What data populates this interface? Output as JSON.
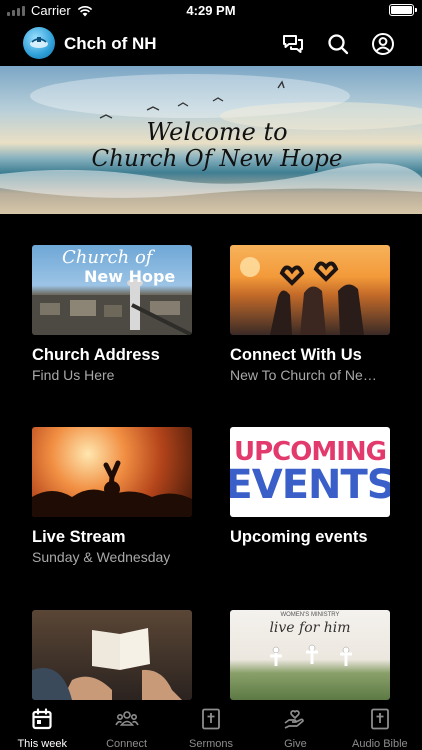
{
  "status_bar": {
    "carrier": "Carrier",
    "time": "4:29 PM"
  },
  "header": {
    "title": "Chch of NH",
    "icons": [
      "chat-icon",
      "search-icon",
      "profile-icon"
    ]
  },
  "hero": {
    "line1": "Welcome to",
    "line2": "Church Of New Hope"
  },
  "cards": [
    {
      "title": "Church Address",
      "subtitle": "Find Us Here",
      "thumb_text_1": "Church of",
      "thumb_text_2": "New Hope"
    },
    {
      "title": "Connect With Us",
      "subtitle": "New To Church of New Hope"
    },
    {
      "title": "Live Stream",
      "subtitle": "Sunday & Wednesday"
    },
    {
      "title": "Upcoming events",
      "subtitle": "",
      "thumb_text_1": "UPCOMING",
      "thumb_text_2": "EVENTS"
    },
    {
      "title": "",
      "subtitle": ""
    },
    {
      "title": "",
      "subtitle": "",
      "thumb_text_1": "WOMEN'S MINISTRY",
      "thumb_text_2": "live for him"
    }
  ],
  "tabs": [
    {
      "label": "This week",
      "icon": "calendar-icon",
      "active": true
    },
    {
      "label": "Connect",
      "icon": "group-icon",
      "active": false
    },
    {
      "label": "Sermons",
      "icon": "bible-cross-icon",
      "active": false
    },
    {
      "label": "Give",
      "icon": "give-hand-icon",
      "active": false
    },
    {
      "label": "Audio Bible",
      "icon": "audio-bible-icon",
      "active": false
    }
  ],
  "colors": {
    "background": "#000000",
    "active_tab": "#ffffff",
    "inactive_tab": "#8d8d8d",
    "subtitle": "#a8a8a8"
  }
}
